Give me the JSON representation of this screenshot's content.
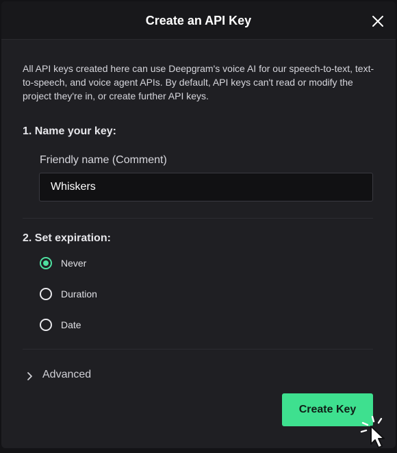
{
  "dialog": {
    "title": "Create an API Key",
    "close_icon": "close-icon",
    "intro": "All API keys created here can use Deepgram's voice AI for our speech-to-text, text-to-speech, and voice agent APIs. By default, API keys can't read or modify the project they're in, or create further API keys."
  },
  "name_section": {
    "heading": "1. Name your key:",
    "field_label": "Friendly name (Comment)",
    "field_value": "Whiskers"
  },
  "expiration_section": {
    "heading": "2. Set expiration:",
    "options": [
      {
        "label": "Never",
        "selected": true
      },
      {
        "label": "Duration",
        "selected": false
      },
      {
        "label": "Date",
        "selected": false
      }
    ]
  },
  "advanced": {
    "label": "Advanced",
    "icon": "chevron-right-icon"
  },
  "actions": {
    "create_label": "Create Key"
  },
  "colors": {
    "accent": "#3ee08f",
    "background": "#1f1f23",
    "header": "#18181b"
  }
}
